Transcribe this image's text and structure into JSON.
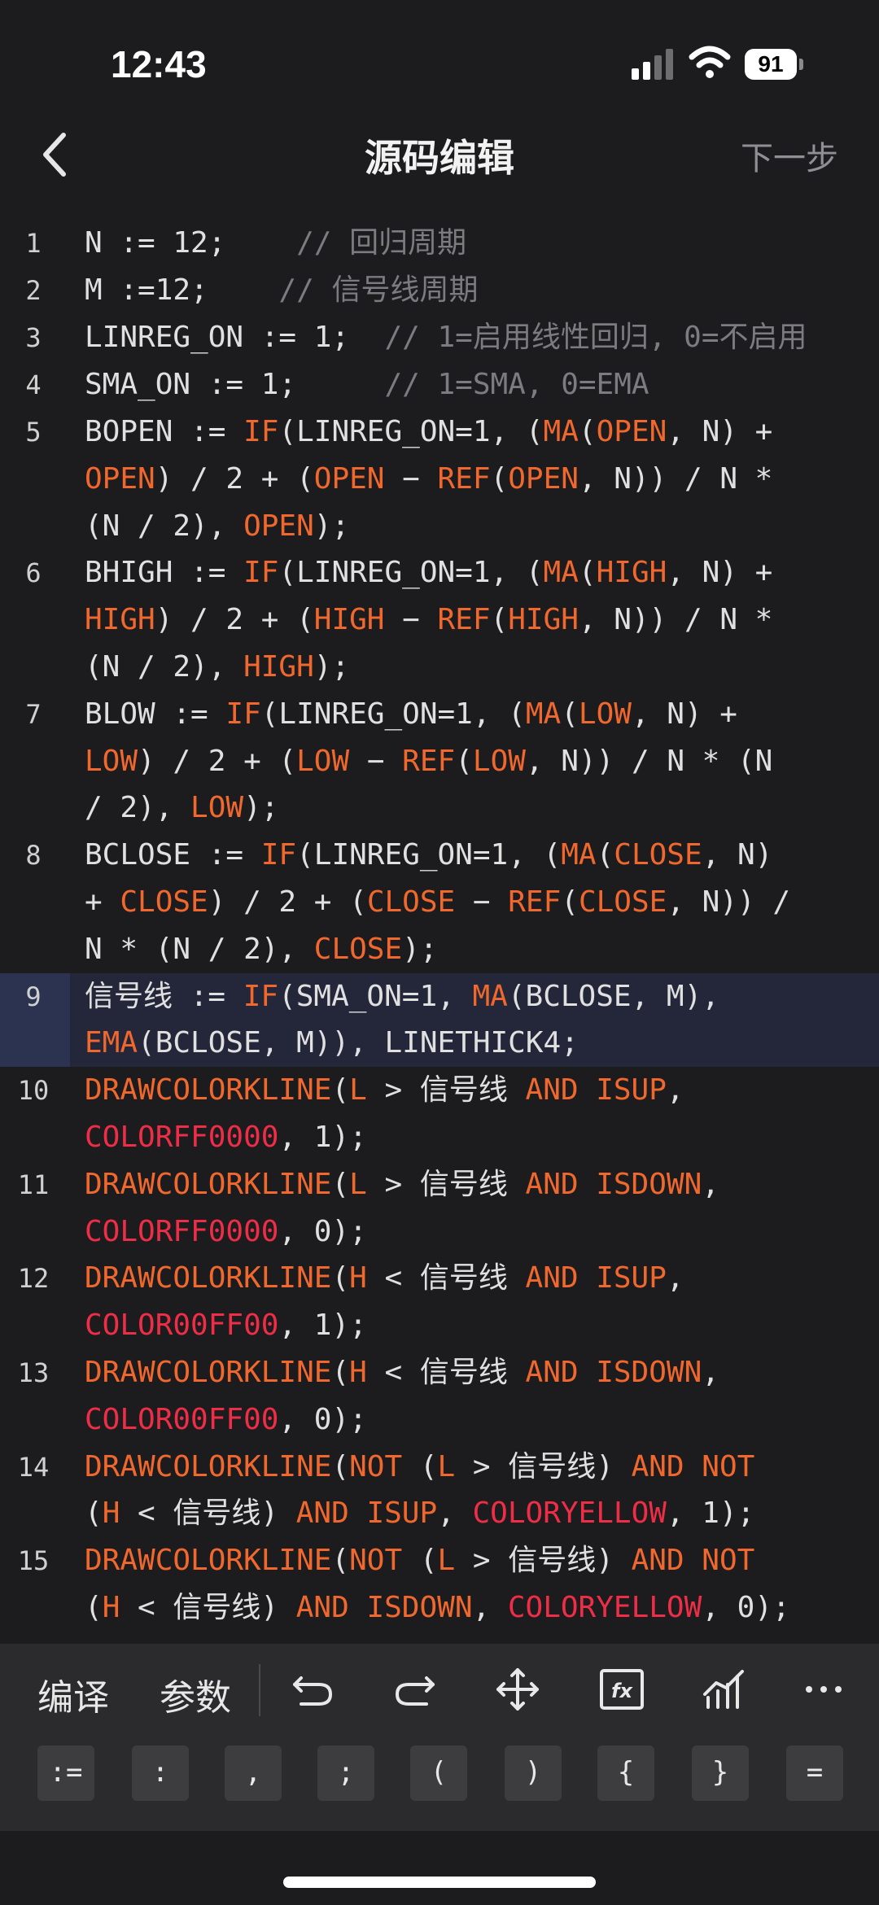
{
  "status": {
    "time": "12:43",
    "battery": "91"
  },
  "nav": {
    "title": "源码编辑",
    "next": "下一步"
  },
  "toolbar": {
    "compile": "编译",
    "params": "参数"
  },
  "keys": [
    ":=",
    ":",
    ",",
    ";",
    "(",
    ")",
    "{",
    "}",
    "="
  ],
  "code": [
    {
      "n": "1",
      "segs": [
        [
          "N := 12;    ",
          ""
        ],
        [
          "// 回归周期",
          "cm"
        ]
      ]
    },
    {
      "n": "2",
      "segs": [
        [
          "M :=12;    ",
          ""
        ],
        [
          "// 信号线周期",
          "cm"
        ]
      ]
    },
    {
      "n": "3",
      "segs": [
        [
          "LINREG_ON := 1;  ",
          ""
        ],
        [
          "// 1=启用线性回归, 0=不启用",
          "cm"
        ]
      ]
    },
    {
      "n": "4",
      "segs": [
        [
          "SMA_ON := 1;     ",
          ""
        ],
        [
          "// 1=SMA, 0=EMA",
          "cm"
        ]
      ]
    },
    {
      "n": "5",
      "segs": [
        [
          "BOPEN := ",
          ""
        ],
        [
          "IF",
          "kw"
        ],
        [
          "(LINREG_ON=1, (",
          ""
        ],
        [
          "MA",
          "kw"
        ],
        [
          "(",
          ""
        ],
        [
          "OPEN",
          "kw"
        ],
        [
          ", N) +\n",
          ""
        ],
        [
          "OPEN",
          "kw"
        ],
        [
          ") / 2 + (",
          ""
        ],
        [
          "OPEN",
          "kw"
        ],
        [
          " − ",
          ""
        ],
        [
          "REF",
          "kw"
        ],
        [
          "(",
          ""
        ],
        [
          "OPEN",
          "kw"
        ],
        [
          ", N)) / N *\n(N / 2), ",
          ""
        ],
        [
          "OPEN",
          "kw"
        ],
        [
          ");",
          ""
        ]
      ]
    },
    {
      "n": "6",
      "segs": [
        [
          "BHIGH := ",
          ""
        ],
        [
          "IF",
          "kw"
        ],
        [
          "(LINREG_ON=1, (",
          ""
        ],
        [
          "MA",
          "kw"
        ],
        [
          "(",
          ""
        ],
        [
          "HIGH",
          "kw"
        ],
        [
          ", N) +\n",
          ""
        ],
        [
          "HIGH",
          "kw"
        ],
        [
          ") / 2 + (",
          ""
        ],
        [
          "HIGH",
          "kw"
        ],
        [
          " − ",
          ""
        ],
        [
          "REF",
          "kw"
        ],
        [
          "(",
          ""
        ],
        [
          "HIGH",
          "kw"
        ],
        [
          ", N)) / N *\n(N / 2), ",
          ""
        ],
        [
          "HIGH",
          "kw"
        ],
        [
          ");",
          ""
        ]
      ]
    },
    {
      "n": "7",
      "segs": [
        [
          "BLOW := ",
          ""
        ],
        [
          "IF",
          "kw"
        ],
        [
          "(LINREG_ON=1, (",
          ""
        ],
        [
          "MA",
          "kw"
        ],
        [
          "(",
          ""
        ],
        [
          "LOW",
          "kw"
        ],
        [
          ", N) +\n",
          ""
        ],
        [
          "LOW",
          "kw"
        ],
        [
          ") / 2 + (",
          ""
        ],
        [
          "LOW",
          "kw"
        ],
        [
          " − ",
          ""
        ],
        [
          "REF",
          "kw"
        ],
        [
          "(",
          ""
        ],
        [
          "LOW",
          "kw"
        ],
        [
          ", N)) / N * (N\n/ 2), ",
          ""
        ],
        [
          "LOW",
          "kw"
        ],
        [
          ");",
          ""
        ]
      ]
    },
    {
      "n": "8",
      "segs": [
        [
          "BCLOSE := ",
          ""
        ],
        [
          "IF",
          "kw"
        ],
        [
          "(LINREG_ON=1, (",
          ""
        ],
        [
          "MA",
          "kw"
        ],
        [
          "(",
          ""
        ],
        [
          "CLOSE",
          "kw"
        ],
        [
          ", N)\n+ ",
          ""
        ],
        [
          "CLOSE",
          "kw"
        ],
        [
          ") / 2 + (",
          ""
        ],
        [
          "CLOSE",
          "kw"
        ],
        [
          " − ",
          ""
        ],
        [
          "REF",
          "kw"
        ],
        [
          "(",
          ""
        ],
        [
          "CLOSE",
          "kw"
        ],
        [
          ", N)) /\nN * (N / 2), ",
          ""
        ],
        [
          "CLOSE",
          "kw"
        ],
        [
          ");",
          ""
        ]
      ]
    },
    {
      "n": "9",
      "active": true,
      "segs": [
        [
          "信号线 := ",
          ""
        ],
        [
          "IF",
          "kw"
        ],
        [
          "(SMA_ON=1, ",
          ""
        ],
        [
          "MA",
          "kw"
        ],
        [
          "(BCLOSE, M),\n",
          ""
        ],
        [
          "EMA",
          "kw"
        ],
        [
          "(BCLOSE, M)), LINETHICK4;",
          ""
        ]
      ]
    },
    {
      "n": "10",
      "segs": [
        [
          "DRAWCOLORKLINE",
          "kw"
        ],
        [
          "(",
          ""
        ],
        [
          "L",
          "kw"
        ],
        [
          " > 信号线 ",
          ""
        ],
        [
          "AND ISUP",
          "kw"
        ],
        [
          ",\n",
          ""
        ],
        [
          "COLORFF0000",
          "col"
        ],
        [
          ", 1);",
          ""
        ]
      ]
    },
    {
      "n": "11",
      "segs": [
        [
          "DRAWCOLORKLINE",
          "kw"
        ],
        [
          "(",
          ""
        ],
        [
          "L",
          "kw"
        ],
        [
          " > 信号线 ",
          ""
        ],
        [
          "AND ISDOWN",
          "kw"
        ],
        [
          ",\n",
          ""
        ],
        [
          "COLORFF0000",
          "col"
        ],
        [
          ", 0);",
          ""
        ]
      ]
    },
    {
      "n": "12",
      "segs": [
        [
          "DRAWCOLORKLINE",
          "kw"
        ],
        [
          "(",
          ""
        ],
        [
          "H",
          "kw"
        ],
        [
          " < 信号线 ",
          ""
        ],
        [
          "AND ISUP",
          "kw"
        ],
        [
          ",\n",
          ""
        ],
        [
          "COLOR00FF00",
          "col"
        ],
        [
          ", 1);",
          ""
        ]
      ]
    },
    {
      "n": "13",
      "segs": [
        [
          "DRAWCOLORKLINE",
          "kw"
        ],
        [
          "(",
          ""
        ],
        [
          "H",
          "kw"
        ],
        [
          " < 信号线 ",
          ""
        ],
        [
          "AND ISDOWN",
          "kw"
        ],
        [
          ",\n",
          ""
        ],
        [
          "COLOR00FF00",
          "col"
        ],
        [
          ", 0);",
          ""
        ]
      ]
    },
    {
      "n": "14",
      "segs": [
        [
          "DRAWCOLORKLINE",
          "kw"
        ],
        [
          "(",
          ""
        ],
        [
          "NOT",
          "kw"
        ],
        [
          " (",
          ""
        ],
        [
          "L",
          "kw"
        ],
        [
          " > 信号线) ",
          ""
        ],
        [
          "AND NOT",
          "kw"
        ],
        [
          "\n(",
          ""
        ],
        [
          "H",
          "kw"
        ],
        [
          " < 信号线) ",
          ""
        ],
        [
          "AND ISUP",
          "kw"
        ],
        [
          ", ",
          ""
        ],
        [
          "COLORYELLOW",
          "col"
        ],
        [
          ", 1);",
          ""
        ]
      ]
    },
    {
      "n": "15",
      "segs": [
        [
          "DRAWCOLORKLINE",
          "kw"
        ],
        [
          "(",
          ""
        ],
        [
          "NOT",
          "kw"
        ],
        [
          " (",
          ""
        ],
        [
          "L",
          "kw"
        ],
        [
          " > 信号线) ",
          ""
        ],
        [
          "AND NOT",
          "kw"
        ],
        [
          "\n(",
          ""
        ],
        [
          "H",
          "kw"
        ],
        [
          " < 信号线) ",
          ""
        ],
        [
          "AND ISDOWN",
          "kw"
        ],
        [
          ", ",
          ""
        ],
        [
          "COLORYELLOW",
          "col"
        ],
        [
          ", 0);",
          ""
        ]
      ]
    }
  ]
}
